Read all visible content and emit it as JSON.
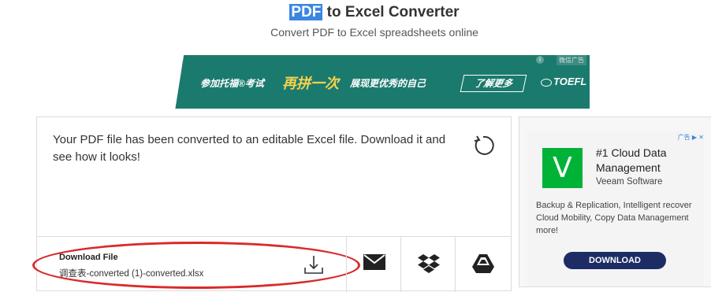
{
  "header": {
    "title_highlight": "PDF",
    "title_rest": " to Excel Converter",
    "subtitle": "Convert PDF to Excel spreadsheets online"
  },
  "banner_ad": {
    "ad_tag": "微信广告",
    "text1": "参加托福®考试",
    "text2": "再拼一次",
    "text3": "展现更优秀的自己",
    "button": "了解更多",
    "logo": "TOEFL"
  },
  "card": {
    "message": "Your PDF file has been converted to an editable Excel file. Download it and see how it looks!",
    "download_label": "Download File",
    "file_name": "调查表-converted (1)-converted.xlsx"
  },
  "icons": {
    "refresh": "refresh-icon",
    "download": "download-icon",
    "email": "envelope-icon",
    "dropbox": "dropbox-icon",
    "drive": "google-drive-icon"
  },
  "side_ad": {
    "ad_choice": "广告",
    "logo_letter": "V",
    "heading": "#1 Cloud Data Management",
    "sub": "Veeam Software",
    "body": "Backup & Replication, Intelligent recover Cloud Mobility, Copy Data Management more!",
    "button": "DOWNLOAD"
  },
  "colors": {
    "highlight": "#3a86e0",
    "banner_bg": "#1b7a6e",
    "banner_accent": "#f7d24c",
    "annotation_red": "#d92a2a",
    "veeam_green": "#00b336",
    "ad_button": "#1d2c64"
  }
}
